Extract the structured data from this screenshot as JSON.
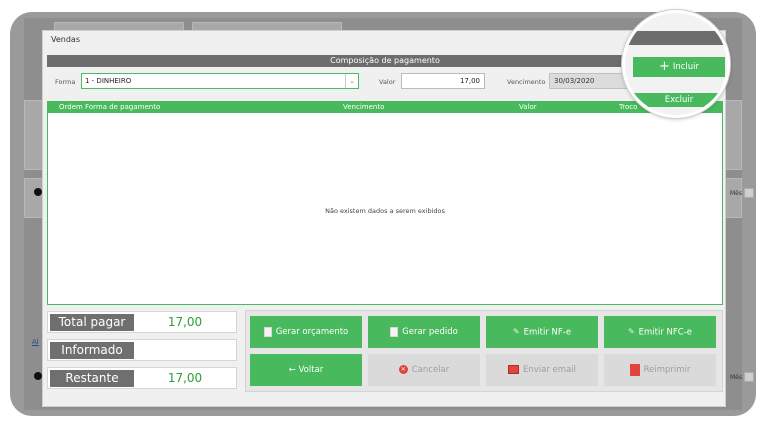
{
  "modal": {
    "title": "Vendas"
  },
  "composicao": {
    "header": "Composição de pagamento",
    "forma_label": "Forma",
    "forma_value": "1 - DINHEIRO",
    "valor_label": "Valor",
    "valor_value": "17,00",
    "vencimento_label": "Vencimento",
    "vencimento_value": "30/03/2020"
  },
  "actions": {
    "incluir": "Incluir",
    "excluir": "Excluir"
  },
  "grid": {
    "columns": [
      "Ordem Forma de pagamento",
      "Vencimento",
      "Valor",
      "Troco"
    ],
    "empty_message": "Não existem dados a serem exibidos"
  },
  "totals": {
    "total_pagar_label": "Total pagar",
    "total_pagar_value": "17,00",
    "informado_label": "Informado",
    "informado_value": "",
    "restante_label": "Restante",
    "restante_value": "17,00"
  },
  "buttons": {
    "gerar_orcamento": "Gerar orçamento",
    "gerar_pedido": "Gerar pedido",
    "emitir_nfe": "Emitir NF-e",
    "emitir_nfce": "Emitir NFC-e",
    "voltar": "← Voltar",
    "cancelar": "Cancelar",
    "enviar_email": "Enviar email",
    "reimprimir": "Reimprimir"
  },
  "background": {
    "mes_label": "Mês",
    "link_text": "Al"
  },
  "colors": {
    "accent": "#48b95c",
    "header_gray": "#6d6d6d",
    "value_green": "#2a9d3a",
    "danger": "#e0443a"
  },
  "icons": [
    "plus-icon",
    "document-icon",
    "pin-icon",
    "cancel-icon",
    "email-icon",
    "pdf-icon",
    "chevron-down-icon",
    "info-icon"
  ]
}
